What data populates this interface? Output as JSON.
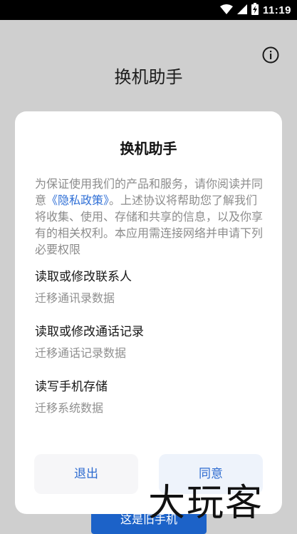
{
  "status_bar": {
    "time": "11:19"
  },
  "header": {
    "title": "换机助手"
  },
  "dialog": {
    "title": "换机助手",
    "intro_before": "为保证使用我们的产品和服务，请你阅读并同意",
    "policy_link": "《隐私政策》",
    "intro_after": "。上述协议将帮助您了解我们将收集、使用、存储和共享的信息，以及你享有的相关权利。本应用需连接网络并申请下列必要权限",
    "permissions": [
      {
        "title": "读取或修改联系人",
        "desc": "迁移通讯录数据"
      },
      {
        "title": "读取或修改通话记录",
        "desc": "迁移通话记录数据"
      },
      {
        "title": "读写手机存储",
        "desc": "迁移系统数据"
      }
    ],
    "exit_label": "退出",
    "agree_label": "同意"
  },
  "background_button": {
    "label": "这是旧手机"
  },
  "watermark": {
    "text": "大玩客"
  },
  "icons": [
    "wifi-icon",
    "signal-icon",
    "battery-charging-icon",
    "info-icon"
  ],
  "colors": {
    "accent": "#2d6bd0",
    "primary_button": "#1c62c8",
    "overlay": "#cfcfcf"
  }
}
